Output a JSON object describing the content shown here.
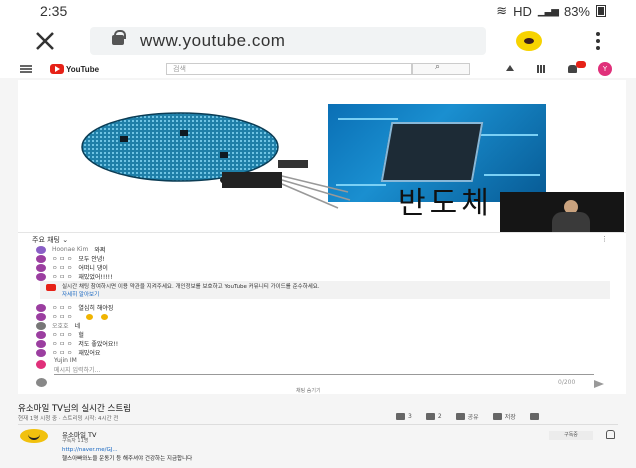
{
  "status_bar": {
    "time": "2:35",
    "network": "HD",
    "battery": "83%"
  },
  "browser": {
    "url": "www.youtube.com"
  },
  "youtube_header": {
    "logo": "YouTube",
    "search_placeholder": "검색"
  },
  "video": {
    "overlay_caption": "반도체"
  },
  "chat": {
    "header": "주요 채팅 ⌄",
    "messages": [
      {
        "name": "Hoonae Kim",
        "text": "와쩌"
      },
      {
        "name": "ㅇ ㅁ ㅇ",
        "text": "모두 안녕!"
      },
      {
        "name": "ㅇ ㅁ ㅇ",
        "text": "어떠니 댕이"
      },
      {
        "name": "ㅇ ㅁ ㅇ",
        "text": "재밌었어!!!!!"
      },
      {
        "name": "ㅇ ㅁ ㅇ",
        "text": "열심히 해야징"
      },
      {
        "name": "ㅇ ㅁ ㅇ",
        "text": ""
      },
      {
        "name": "오호호",
        "text": "네"
      },
      {
        "name": "ㅇ ㅁ ㅇ",
        "text": "헐"
      },
      {
        "name": "ㅇ ㅁ ㅇ",
        "text": "저도 좋았어요!!"
      },
      {
        "name": "ㅇ ㅁ ㅇ",
        "text": "재밌어요"
      }
    ],
    "notice_text": "실시간 채팅 참여하시면 이용 약관을 지켜주세요. 개인정보를 보호하고 YouTube 커뮤니티 가이드를 준수하세요.",
    "notice_link": "자세히 알아보기",
    "input_user": "Yujin IM",
    "input_placeholder": "메시지 입력하기...",
    "char_count": "0/200",
    "hide_label": "채팅 숨기기"
  },
  "info": {
    "title": "유소마일 TV님의 실시간 스트림",
    "meta": "현재 1명 시청 중 · 스트리밍 시작: 4시간 전",
    "likes": "3",
    "dislikes": "2",
    "share": "공유",
    "save": "저장",
    "channel_name": "유소마일 TV",
    "subscribers": "구독자 11명",
    "subscribed_label": "구독중",
    "link": "http://naver.me/GJ...",
    "description": "헬스아빠와노을 운동기 등 해주셔야 건강하는 지금합니다"
  }
}
